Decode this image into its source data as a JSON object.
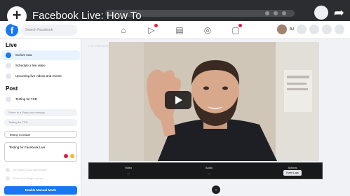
{
  "youtube": {
    "logo_glyph": "+",
    "title": "Facebook Live: How To"
  },
  "facebook": {
    "logo": "f",
    "search_placeholder": "Search Facebook",
    "user_name": "AJ"
  },
  "sidebar": {
    "live_heading": "Live",
    "items": [
      {
        "label": "Go live now",
        "active": true
      },
      {
        "label": "Schedule a live video",
        "active": false
      },
      {
        "label": "Upcoming live videos and events",
        "active": false
      }
    ],
    "post_heading": "Post",
    "posting_as": "Testing for TSD",
    "fields": [
      "Share in a Page you manage",
      "Testing for TSD"
    ],
    "title_value": "Testing Schedule",
    "description_value": "Testing for Facebook Live",
    "muted_options": [
      "Go Right to Live and create",
      "Share to a Page's group"
    ],
    "cta_label": "Enable Manual Mode"
  },
  "main": {
    "preview_label": "LIVE PREVIEW",
    "stats": [
      {
        "heading": "Video",
        "value": "—"
      },
      {
        "heading": "Audio",
        "value": "—"
      },
      {
        "heading": "Actions",
        "value": ""
      }
    ],
    "event_logs_label": "Event Logs",
    "scroll_glyph": "⌄"
  },
  "colors": {
    "fb_blue": "#1877f2",
    "notification_red": "#e41e3f",
    "video_bg": "#262830"
  }
}
